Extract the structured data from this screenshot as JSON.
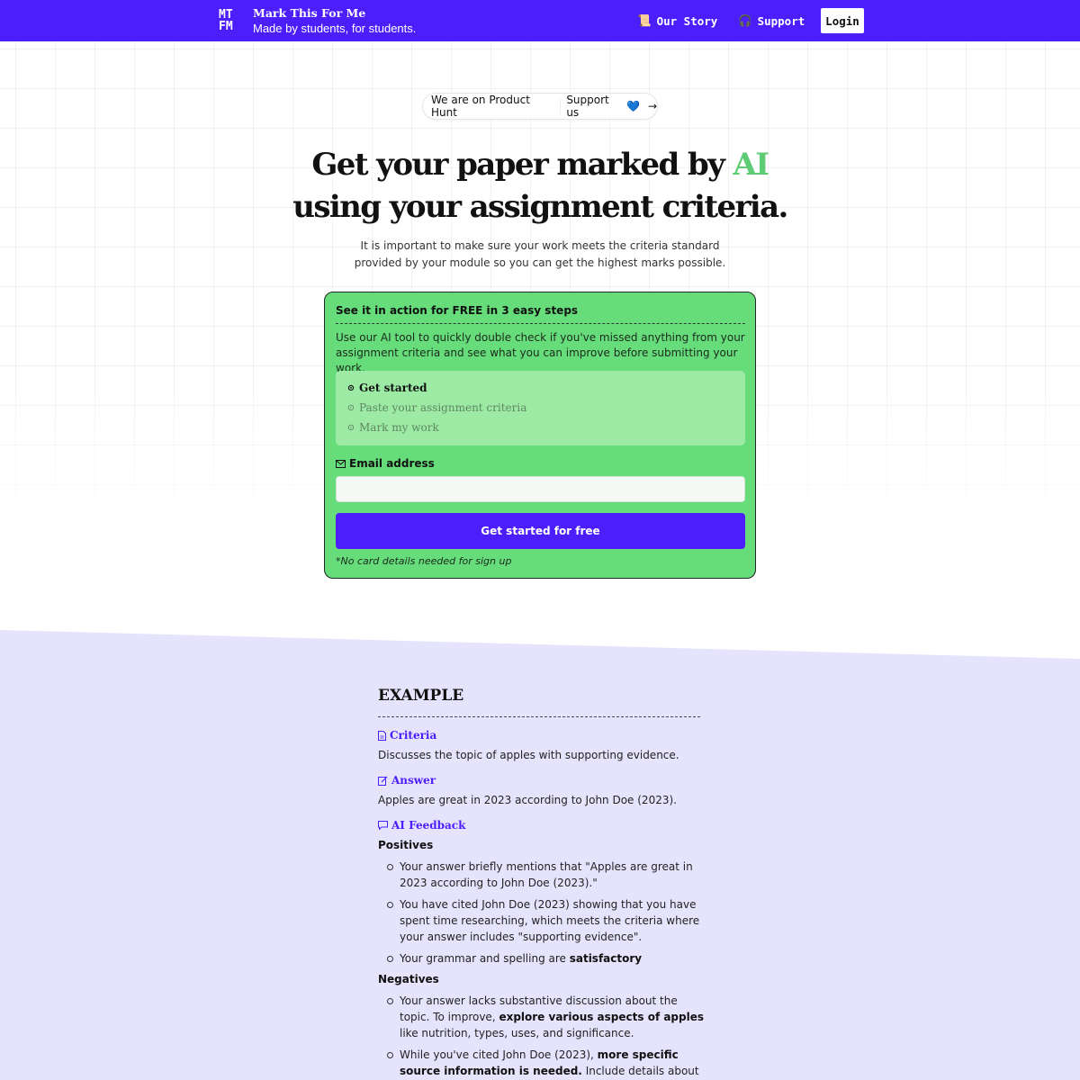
{
  "header": {
    "logo_top": "MT",
    "logo_bottom": "FM",
    "brand_name": "Mark This For Me",
    "tagline": "Made by students, for students.",
    "nav_story_icon": "📜",
    "nav_story": "Our Story",
    "nav_support_icon": "🎧",
    "nav_support": "Support",
    "login": "Login",
    "brand_color": "#4b1efb"
  },
  "product_hunt": {
    "text": "We are on Product Hunt",
    "support": "Support us",
    "heart": "💙",
    "arrow": "→"
  },
  "hero": {
    "title_part1": "Get your paper marked by ",
    "title_highlight": "AI",
    "title_part2": "using your assignment criteria.",
    "subtitle": "It is important to make sure your work meets the criteria standard provided by your module so you can get the highest marks possible.",
    "highlight_color": "#5dcc74"
  },
  "signup_card": {
    "title": "See it in action for FREE in 3 easy steps",
    "description": "Use our AI tool to quickly double check if you've missed anything from your assignment criteria and see what you can improve before submitting your work.",
    "steps": [
      {
        "label": "Get started",
        "active": true
      },
      {
        "label": "Paste your assignment criteria",
        "active": false
      },
      {
        "label": "Mark my work",
        "active": false
      }
    ],
    "email_label": "Email address",
    "email_value": "",
    "email_placeholder": "",
    "cta": "Get started for free",
    "note": "*No card details needed for sign up",
    "bg_color": "#66dd7a"
  },
  "example": {
    "title": "EXAMPLE",
    "criteria_label": "Criteria",
    "criteria_text": "Discusses the topic of apples with supporting evidence.",
    "answer_label": "Answer",
    "answer_text": "Apples are great in 2023 according to John Doe (2023).",
    "feedback_label": "AI Feedback",
    "positives_label": "Positives",
    "positives": [
      {
        "pre": "Your answer briefly mentions that \"Apples are great in 2023 according to John Doe (2023).\"",
        "bold": "",
        "post": ""
      },
      {
        "pre": "You have cited John Doe (2023) showing that you have spent time researching, which meets the criteria where your answer includes \"supporting evidence\".",
        "bold": "",
        "post": ""
      },
      {
        "pre": "Your grammar and spelling are ",
        "bold": "satisfactory",
        "post": ""
      }
    ],
    "negatives_label": "Negatives",
    "negatives": [
      {
        "pre": "Your answer lacks substantive discussion about the topic. To improve, ",
        "bold": "explore various aspects of apples",
        "post": " like nutrition, types, uses, and significance."
      },
      {
        "pre": "While you've cited John Doe (2023), ",
        "bold": "more specific source information is needed.",
        "post": " Include details about the research"
      }
    ],
    "bg_color": "#e6e4fd"
  }
}
